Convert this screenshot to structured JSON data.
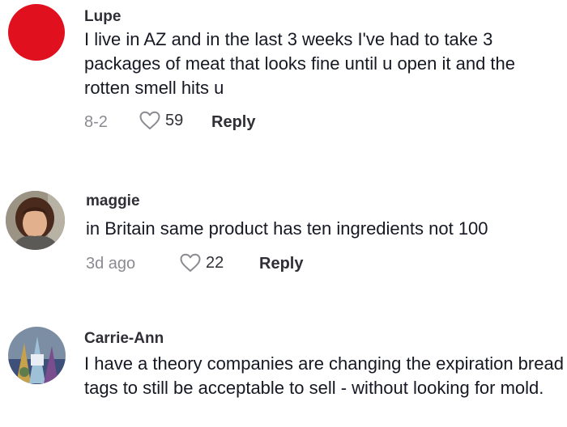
{
  "comments": [
    {
      "username": "Lupe",
      "text": "I live in AZ and in the last 3 weeks I've had to take 3 packages of meat that looks fine until u open it and the rotten smell hits u",
      "date": "8-2",
      "likes": "59",
      "reply_label": "Reply",
      "avatar_color": "#e0101e"
    },
    {
      "username": "maggie",
      "text": "in Britain same product has ten ingredients not 100",
      "date": "3d ago",
      "likes": "22",
      "reply_label": "Reply"
    },
    {
      "username": "Carrie-Ann",
      "text": "I have a theory companies are changing the expiration bread tags to still be acceptable to sell - without looking for mold."
    }
  ],
  "icons": {
    "like": "heart-outline-icon"
  }
}
